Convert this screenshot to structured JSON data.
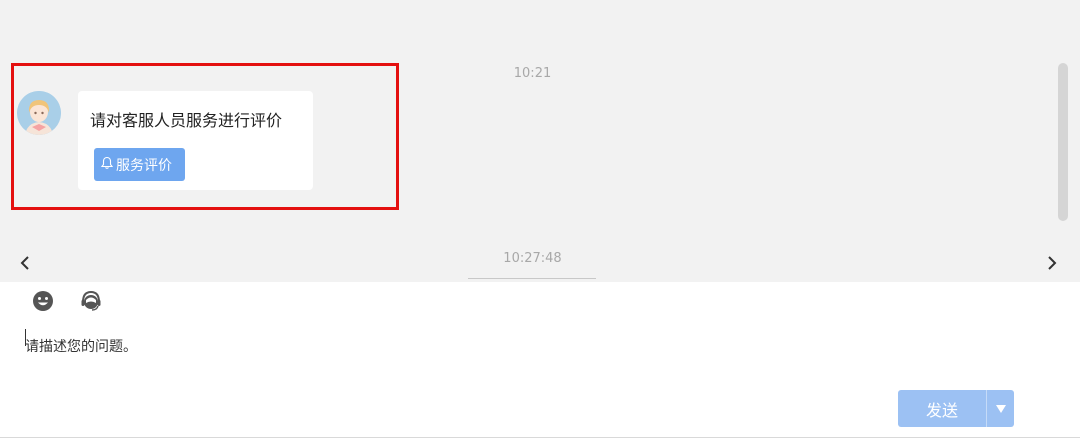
{
  "chat": {
    "time_1": "10:21",
    "time_2": "10:27:48",
    "message": {
      "text": "请对客服人员服务进行评价",
      "button_label": "服务评价",
      "avatar_icon": "customer-service-avatar-icon",
      "button_icon": "bell-icon"
    },
    "nav": {
      "prev_icon": "chevron-left-icon",
      "next_icon": "chevron-right-icon"
    }
  },
  "composer": {
    "toolbar": {
      "emoji_icon": "smiley-face-icon",
      "agent_icon": "headset-agent-icon"
    },
    "input_placeholder": "请描述您的问题。",
    "send_label": "发送",
    "dropdown_icon": "triangle-down-icon"
  },
  "colors": {
    "chat_background": "#f2f2f2",
    "highlight_border": "#e4100f",
    "eval_button": "#6ea6ef",
    "send_button": "#9cc1f3"
  }
}
